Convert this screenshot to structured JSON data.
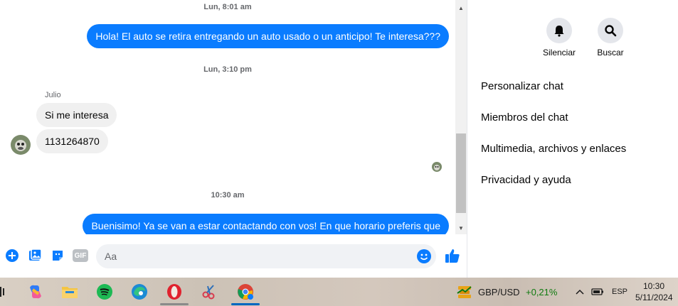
{
  "chat": {
    "timestamps": [
      "Lun, 8:01 am",
      "Lun, 3:10 pm",
      "10:30 am"
    ],
    "messages": [
      {
        "direction": "out",
        "text": "Hola! El auto se retira entregando un auto usado o un anticipo! Te interesa???"
      },
      {
        "direction": "in",
        "sender": "Julio",
        "text": "Si me interesa"
      },
      {
        "direction": "in",
        "sender": "Julio",
        "text": "1131264870"
      },
      {
        "direction": "out",
        "text": "Buenisimo! Ya se van a estar contactando con vos! En que horario preferis que"
      }
    ],
    "sender_name": "Julio"
  },
  "composer": {
    "placeholder": "Aa",
    "gif_label": "GIF"
  },
  "side_panel": {
    "mute_label": "Silenciar",
    "search_label": "Buscar",
    "menu": [
      "Personalizar chat",
      "Miembros del chat",
      "Multimedia, archivos y enlaces",
      "Privacidad y ayuda"
    ]
  },
  "taskbar": {
    "ticker_name": "GBP/USD",
    "ticker_change": "+0,21%",
    "language": "ESP",
    "time": "10:30",
    "date": "5/11/2024"
  },
  "colors": {
    "accent": "#0a7cff",
    "ticker_positive": "#0f7b0f"
  }
}
